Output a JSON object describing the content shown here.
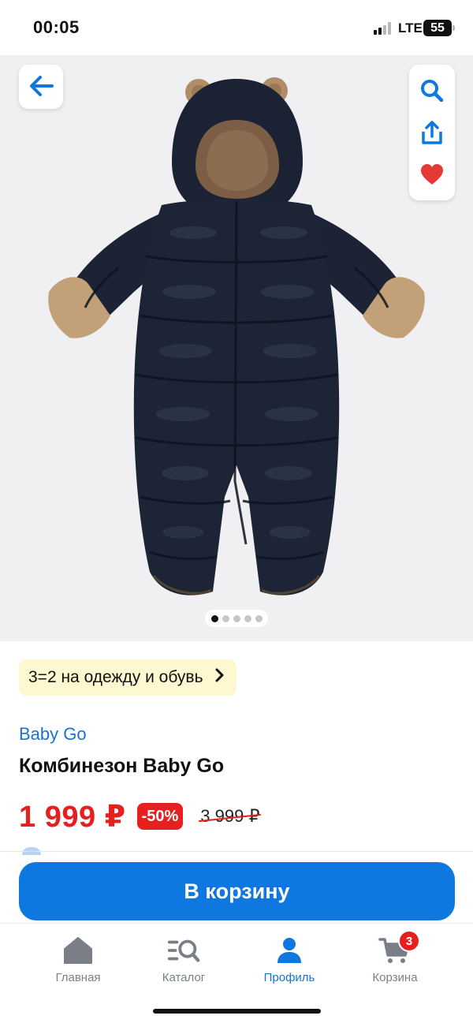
{
  "status_bar": {
    "time": "00:05",
    "network": "LTE",
    "battery": "55"
  },
  "gallery": {
    "image_count": 5,
    "active_index": 0
  },
  "icons": {
    "back": "arrow-left-icon",
    "search": "search-icon",
    "share": "share-icon",
    "favorite": "heart-icon",
    "promo_chevron": "chevron-right-icon"
  },
  "promo": {
    "label": "3=2 на одежду и обувь"
  },
  "product": {
    "brand": "Baby Go",
    "title": "Комбинезон Baby Go",
    "price": "1 999 ₽",
    "discount": "-50%",
    "old_price": "3 999 ₽"
  },
  "cart_button": {
    "label": "В корзину"
  },
  "tab_bar": {
    "items": [
      {
        "label": "Главная",
        "icon": "home-icon"
      },
      {
        "label": "Каталог",
        "icon": "catalog-search-icon"
      },
      {
        "label": "Профиль",
        "icon": "profile-icon"
      },
      {
        "label": "Корзина",
        "icon": "cart-icon",
        "badge": "3"
      }
    ],
    "active": "Профиль"
  },
  "colors": {
    "accent_blue": "#0f77e0",
    "link_blue": "#1a73c8",
    "sale_red": "#e5201f",
    "promo_bg": "#fdf8cf",
    "favorite_red": "#e53935"
  }
}
